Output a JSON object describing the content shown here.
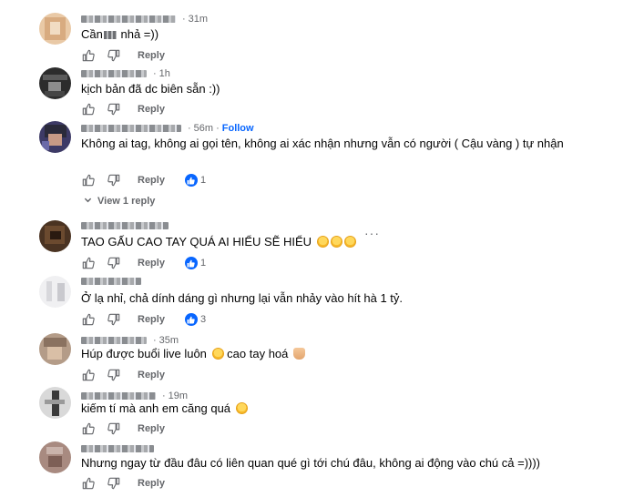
{
  "labels": {
    "reply": "Reply",
    "follow": "Follow",
    "view_replies": "View 1 reply"
  },
  "comments": [
    {
      "time": "31m",
      "text_a": "Cần",
      "text_b": "nhả =))",
      "likes": ""
    },
    {
      "time": "1h",
      "text": "kịch bản đã dc biên sẵn :))",
      "likes": ""
    },
    {
      "time": "56m",
      "text": "Không ai tag, không ai gọi tên, không ai xác nhận nhưng vẫn có người ( Cậu vàng ) tự nhận",
      "likes": "1"
    },
    {
      "time": "",
      "text": "TAO GẤU CAO TAY QUÁ AI HIỂU SẼ HIỂU",
      "likes": "1"
    },
    {
      "time": "",
      "text": "Ở lạ nhỉ, chả dính dáng gì nhưng lại vẫn nhảy vào hít hà 1 tỷ.",
      "likes": "3"
    },
    {
      "time": "35m",
      "text_a": "Húp được buổi live luôn",
      "text_b": "cao tay hoá",
      "likes": ""
    },
    {
      "time": "19m",
      "text": "kiếm tí mà anh em căng quá",
      "likes": ""
    },
    {
      "time": "",
      "text": "Nhưng ngay từ đầu đâu có liên quan qué gì tới chú đâu, không ai động vào chú cả =))))",
      "likes": ""
    }
  ],
  "colors": {
    "accent": "#0866ff",
    "meta": "#65676b",
    "text": "#050505"
  }
}
